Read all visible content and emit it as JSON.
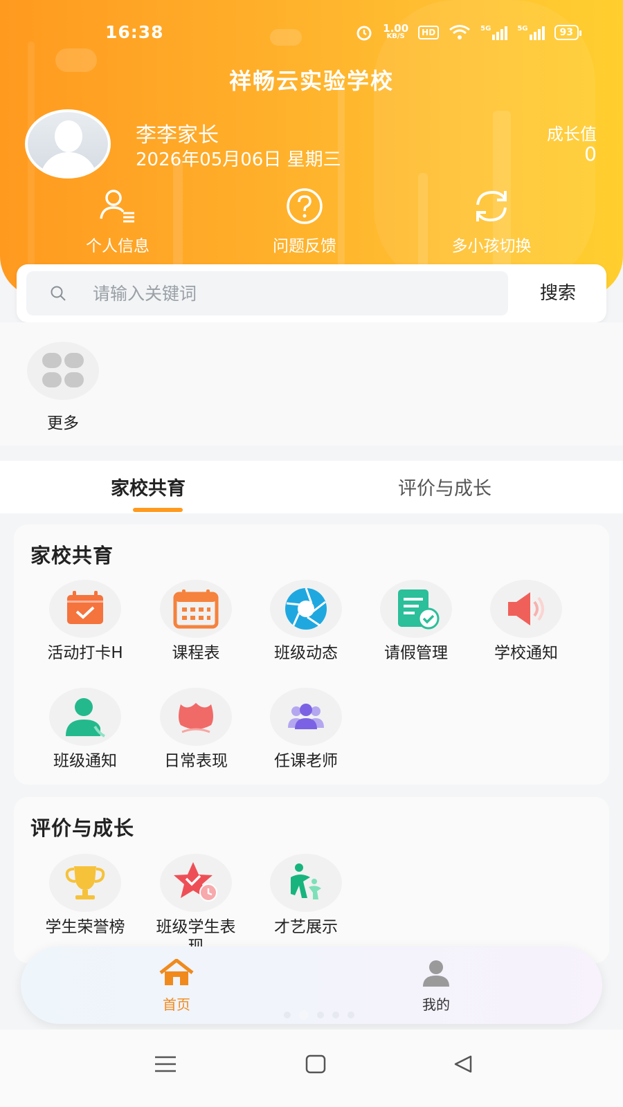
{
  "status_bar": {
    "time": "16:38",
    "net_speed": "1.00",
    "net_unit": "KB/S",
    "hd": "HD",
    "sig1": "5G",
    "sig2": "5G",
    "battery": "93"
  },
  "header": {
    "school_name": "祥畅云实验学校",
    "user_name": "李李家长",
    "date": "2026年05月06日 星期三",
    "growth_label": "成长值",
    "growth_value": "0",
    "quick_actions": [
      {
        "label": "个人信息",
        "icon": "user-info-icon"
      },
      {
        "label": "问题反馈",
        "icon": "question-icon"
      },
      {
        "label": "多小孩切换",
        "icon": "switch-icon"
      }
    ]
  },
  "search": {
    "placeholder": "请输入关键词",
    "button": "搜索"
  },
  "more": {
    "label": "更多",
    "icon": "grid-more-icon"
  },
  "tabs": [
    {
      "label": "家校共育",
      "active": true
    },
    {
      "label": "评价与成长",
      "active": false
    }
  ],
  "sections": [
    {
      "title": "家校共育",
      "items": [
        {
          "label": "活动打卡H",
          "icon": "calendar-check-icon"
        },
        {
          "label": "课程表",
          "icon": "timetable-icon"
        },
        {
          "label": "班级动态",
          "icon": "camera-aperture-icon"
        },
        {
          "label": "请假管理",
          "icon": "leave-document-icon"
        },
        {
          "label": "学校通知",
          "icon": "speaker-icon"
        },
        {
          "label": "班级通知",
          "icon": "person-phone-icon"
        },
        {
          "label": "日常表现",
          "icon": "lotus-icon"
        },
        {
          "label": "任课老师",
          "icon": "group-icon"
        }
      ]
    },
    {
      "title": "评价与成长",
      "items": [
        {
          "label": "学生荣誉榜",
          "icon": "trophy-icon"
        },
        {
          "label": "班级学生表现",
          "icon": "star-clock-icon"
        },
        {
          "label": "才艺展示",
          "icon": "dancer-icon"
        }
      ]
    }
  ],
  "bottom_nav": [
    {
      "label": "首页",
      "icon": "home-icon",
      "active": true
    },
    {
      "label": "我的",
      "icon": "profile-icon",
      "active": false
    }
  ],
  "colors": {
    "accent": "#ff9a1f",
    "header_start": "#ff9a1f",
    "header_end": "#ffcf2e"
  }
}
